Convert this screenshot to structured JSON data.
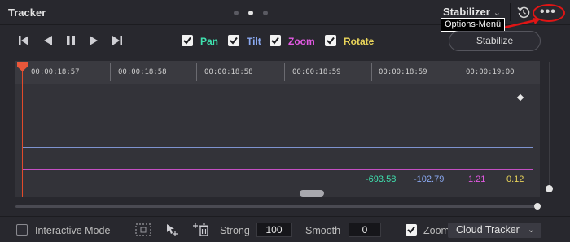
{
  "header": {
    "title": "Tracker",
    "mode": "Stabilizer",
    "annotation": "Options-Menü"
  },
  "toolbar": {
    "options": [
      {
        "label": "Pan",
        "checked": true,
        "color": "#3fe3b0"
      },
      {
        "label": "Tilt",
        "checked": true,
        "color": "#8aa8f0"
      },
      {
        "label": "Zoom",
        "checked": true,
        "color": "#e45ae4"
      },
      {
        "label": "Rotate",
        "checked": true,
        "color": "#e9d45a"
      }
    ],
    "stabilize_label": "Stabilize"
  },
  "timeline": {
    "timecodes": [
      "00:00:18:57",
      "00:00:18:58",
      "00:00:18:58",
      "00:00:18:59",
      "00:00:18:59",
      "00:00:19:00"
    ],
    "values": [
      {
        "text": "-693.58",
        "color": "#3fe3b0"
      },
      {
        "text": "-102.79",
        "color": "#8aa8f0"
      },
      {
        "text": "1.21",
        "color": "#e45ae4"
      },
      {
        "text": "0.12",
        "color": "#e9d45a"
      }
    ]
  },
  "bottombar": {
    "interactive_mode_label": "Interactive Mode",
    "interactive_mode_checked": false,
    "strong_label": "Strong",
    "strong_value": "100",
    "smooth_label": "Smooth",
    "smooth_value": "0",
    "zoom_label": "Zoom",
    "zoom_checked": true,
    "tracker_select": "Cloud Tracker"
  },
  "icons": {
    "transport": [
      "skip-to-start-icon",
      "play-reverse-icon",
      "pause-icon",
      "play-forward-icon",
      "skip-to-end-icon"
    ],
    "header": [
      "reset-icon",
      "more-options-icon"
    ],
    "bottom": [
      "frame-select-icon",
      "pointer-add-icon",
      "add-delete-tracker-icon"
    ]
  },
  "colors": {
    "accent_red": "#e01515",
    "playhead": "#e24a2a"
  }
}
